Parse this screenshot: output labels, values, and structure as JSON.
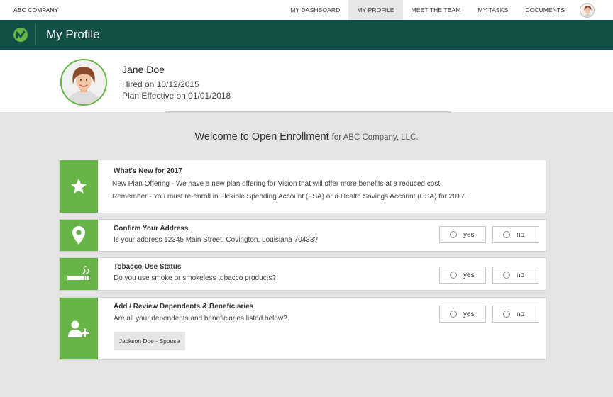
{
  "company": "ABC COMPANY",
  "nav": {
    "items": [
      {
        "label": "MY DASHBOARD",
        "active": false
      },
      {
        "label": "MY PROFILE",
        "active": true
      },
      {
        "label": "MEET THE TEAM",
        "active": false
      },
      {
        "label": "MY TASKS",
        "active": false
      },
      {
        "label": "DOCUMENTS",
        "active": false
      }
    ]
  },
  "header": {
    "title": "My Profile"
  },
  "profile": {
    "name": "Jane Doe",
    "hired": "Hired on 10/12/2015",
    "plan_effective": "Plan Effective on 01/01/2018"
  },
  "welcome": {
    "main": "Welcome to Open Enrollment",
    "sub": "for ABC Company, LLC."
  },
  "cards": {
    "whats_new": {
      "title": "What's New for 2017",
      "line1": "New Plan Offering - We have a new plan offering for Vision that will offer more benefits at a  reduced cost.",
      "line2": "Remember  - You must re-enroll in Flexible Spending Account (FSA) or a Health Savings Account (HSA) for 2017."
    },
    "address": {
      "title": "Confirm Your Address",
      "question": "Is your address 12345 Main Street, Covington, Louisiana 70433?",
      "yes": "yes",
      "no": "no"
    },
    "tobacco": {
      "title": "Tobacco-Use Status",
      "question": "Do you use smoke or smokeless tobacco products?",
      "yes": "yes",
      "no": "no"
    },
    "dependents": {
      "title": "Add / Review Dependents & Beneficiaries",
      "question": "Are all your dependents and beneficiaries listed below?",
      "yes": "yes",
      "no": "no",
      "dependent": "Jackson Doe - Spouse"
    }
  },
  "colors": {
    "header_green": "#124f46",
    "accent_green": "#67b547",
    "background": "#e4e4e4"
  },
  "icons": [
    "logo-icon",
    "star-icon",
    "map-pin-icon",
    "cigarette-icon",
    "add-user-icon"
  ]
}
